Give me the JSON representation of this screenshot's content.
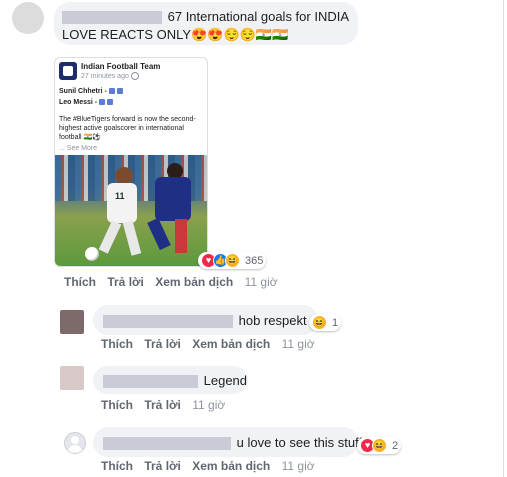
{
  "comments": [
    {
      "text_lines": [
        "67 International goals for INDIA",
        "LOVE REACTS ONLY😍😍😌😌🇮🇳🇮🇳"
      ],
      "reactions_count": "365",
      "actions": [
        "Thích",
        "Trả lời",
        "Xem bản dịch"
      ],
      "time": "11 giờ"
    },
    {
      "text": "hob respekt",
      "reactions_count": "1",
      "actions": [
        "Thích",
        "Trả lời",
        "Xem bản dịch"
      ],
      "time": "11 giờ"
    },
    {
      "text": "Legend",
      "actions": [
        "Thích",
        "Trả lời"
      ],
      "time": "11 giờ"
    },
    {
      "text": "u love to see this stuff",
      "reactions_count": "2",
      "actions": [
        "Thích",
        "Trả lời",
        "Xem bản dịch"
      ],
      "time": "11 giờ"
    }
  ],
  "shared_post": {
    "page_name": "Indian Football Team",
    "time": "27 minutes ago",
    "line1": "Sunil Chhetri - ",
    "line2": "Leo Messi - ",
    "body": "The #BlueTigers forward is now the second-highest active goalscorer in international football 🇮🇳⚽",
    "see_more": "... See More",
    "jersey_number": "11"
  },
  "colors": {
    "love": "#f0284a",
    "like": "#1877f2",
    "haha": "#f7b125",
    "bubble": "#f0f2f5",
    "link": "#385898"
  },
  "icons": [
    "love-reaction-icon",
    "like-reaction-icon",
    "haha-reaction-icon",
    "globe-icon",
    "default-avatar-icon"
  ]
}
